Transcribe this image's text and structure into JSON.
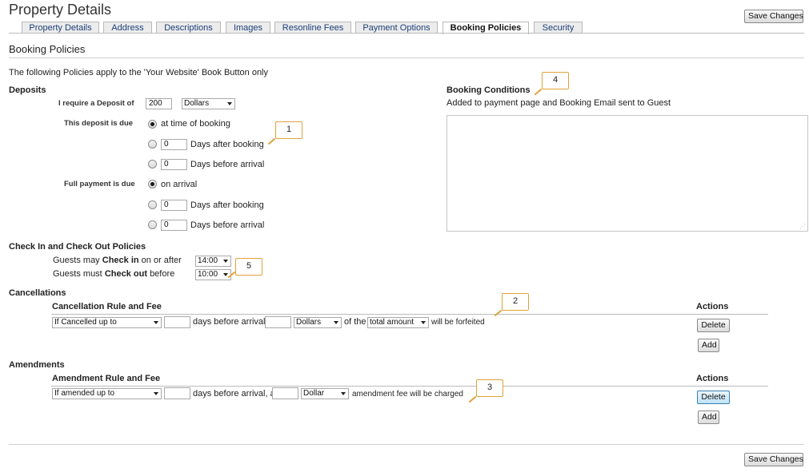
{
  "page": {
    "title": "Property Details",
    "save_label": "Save Changes"
  },
  "tabs": [
    {
      "label": "Property Details"
    },
    {
      "label": "Address"
    },
    {
      "label": "Descriptions"
    },
    {
      "label": "Images"
    },
    {
      "label": "Resonline Fees"
    },
    {
      "label": "Payment Options"
    },
    {
      "label": "Booking Policies"
    },
    {
      "label": "Security"
    }
  ],
  "section": {
    "title": "Booking Policies",
    "intro": "The following Policies apply to the 'Your Website' Book Button only"
  },
  "deposits": {
    "heading": "Deposits",
    "require_label": "I require a Deposit of",
    "amount": "200",
    "currency": "Dollars",
    "due_label": "This deposit is due",
    "due_options": [
      {
        "label": "at time of booking",
        "value": "",
        "checked": true
      },
      {
        "label": "Days after booking",
        "value": "0",
        "checked": false
      },
      {
        "label": "Days before arrival",
        "value": "0",
        "checked": false
      }
    ],
    "full_label": "Full payment is due",
    "full_options": [
      {
        "label": "on arrival",
        "value": "",
        "checked": true
      },
      {
        "label": "Days after booking",
        "value": "0",
        "checked": false
      },
      {
        "label": "Days before arrival",
        "value": "0",
        "checked": false
      }
    ]
  },
  "booking_conditions": {
    "heading": "Booking Conditions",
    "description": "Added to payment page and Booking Email sent to Guest",
    "text": ""
  },
  "checkinout": {
    "heading": "Check In and Check Out Policies",
    "checkin_pre": "Guests may",
    "checkin_bold": "Check in",
    "checkin_post": "on or after",
    "checkin_time": "14:00",
    "checkout_pre": "Guests must",
    "checkout_bold": "Check out",
    "checkout_post": "before",
    "checkout_time": "10:00"
  },
  "cancellations": {
    "heading": "Cancellations",
    "rule_header": "Cancellation Rule and Fee",
    "actions_header": "Actions",
    "rule_select": "If Cancelled up to",
    "days_value": "",
    "days_text": "days before arrival,",
    "fee_value": "",
    "currency": "Dollars",
    "of_the": "of the",
    "basis": "total amount",
    "tail": "will be forfeited",
    "delete_label": "Delete",
    "add_label": "Add"
  },
  "amendments": {
    "heading": "Amendments",
    "rule_header": "Amendment Rule and Fee",
    "actions_header": "Actions",
    "rule_select": "If amended up to",
    "days_value": "",
    "days_text": "days before arrival, a",
    "fee_value": "",
    "currency": "Dollar",
    "tail": "amendment fee will be charged",
    "delete_label": "Delete",
    "add_label": "Add"
  },
  "callouts": [
    "1",
    "2",
    "3",
    "4",
    "5"
  ],
  "colors": {
    "callout_border": "#e0a23a",
    "tab_text": "#1c3f7a"
  }
}
